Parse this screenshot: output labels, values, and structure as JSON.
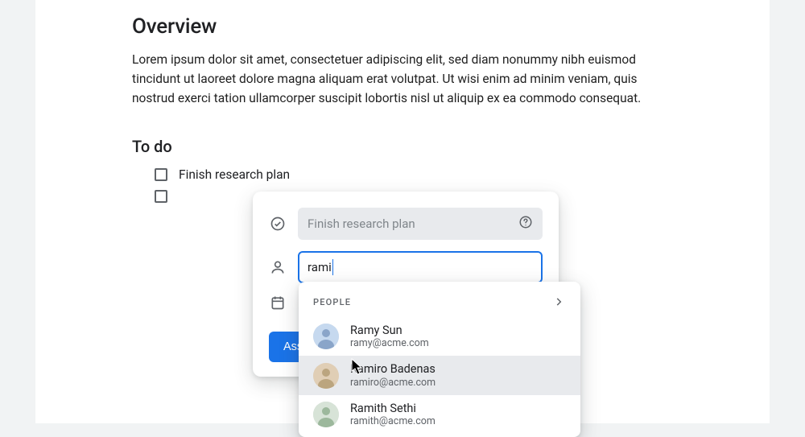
{
  "overview": {
    "title": "Overview",
    "body": "Lorem ipsum dolor sit amet, consectetuer adipiscing elit, sed diam nonummy nibh euismod tincidunt ut laoreet dolore magna aliquam erat volutpat. Ut wisi enim ad minim veniam, quis nostrud exerci tation ullamcorper suscipit lobortis nisl ut aliquip ex ea commodo consequat."
  },
  "todo": {
    "title": "To do",
    "items": [
      {
        "label": "Finish research plan",
        "checked": false
      },
      {
        "label": "",
        "checked": false
      }
    ]
  },
  "task_card": {
    "title_placeholder": "Finish research plan",
    "assignee_value": "rami",
    "assign_button": "Assign",
    "icons": {
      "title": "check-circle-icon",
      "assignee": "person-icon",
      "date": "calendar-icon",
      "help": "help-icon"
    }
  },
  "people_dropdown": {
    "header": "PEOPLE",
    "results": [
      {
        "name": "Ramy Sun",
        "email": "ramy@acme.com",
        "avatar_bg": "#c6d9ef",
        "hover": false
      },
      {
        "name": "Ramiro Badenas",
        "email": "ramiro@acme.com",
        "avatar_bg": "#e0ceb5",
        "hover": true
      },
      {
        "name": "Ramith Sethi",
        "email": "ramith@acme.com",
        "avatar_bg": "#d7e3d7",
        "hover": false
      }
    ]
  }
}
